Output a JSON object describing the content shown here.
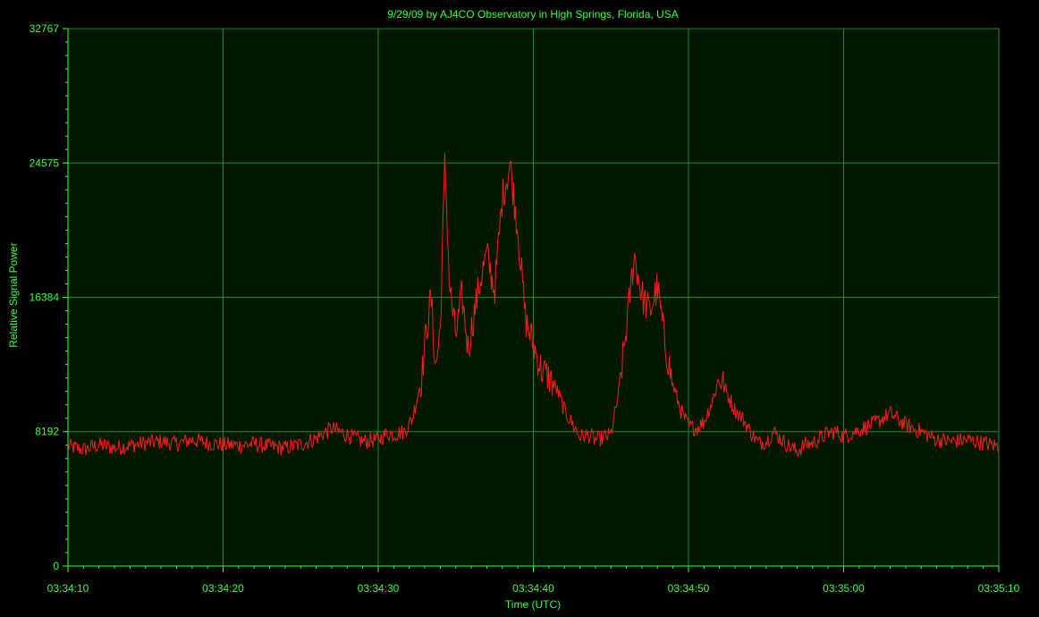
{
  "chart_data": {
    "type": "line",
    "title": "9/29/09  by  AJ4CO Observatory  in  High Springs, Florida, USA",
    "xlabel": "Time (UTC)",
    "ylabel": "Relative Signal Power",
    "x_start_seconds": 0,
    "x_end_seconds": 60,
    "xlim": [
      0,
      60
    ],
    "ylim": [
      0,
      32767
    ],
    "y_ticks": [
      0,
      8192,
      16384,
      24575,
      32767
    ],
    "x_tick_labels": [
      "03:34:10",
      "03:34:20",
      "03:34:30",
      "03:34:40",
      "03:34:50",
      "03:35:00",
      "03:35:10"
    ],
    "grid": true,
    "colors": {
      "background": "#000000",
      "plot_background": "#001800",
      "grid": "#1f8a1f",
      "text": "#33ff33",
      "series": "#ff1a1a"
    },
    "series": [
      {
        "x": [
          0,
          1,
          2,
          3,
          4,
          5,
          6,
          7,
          8,
          9,
          10,
          11,
          12,
          13,
          14,
          15,
          16,
          17,
          18,
          19,
          20,
          21,
          20.6,
          21.2,
          21.7,
          22.2,
          22.8,
          23,
          23.4,
          23.7,
          24,
          24.3,
          24.6,
          25,
          25.4,
          25.8,
          26.2,
          26.6,
          27,
          27.5,
          28,
          28.5,
          29,
          29.5,
          30,
          30.5,
          31,
          31.5,
          32,
          32.5,
          33,
          33.5,
          34,
          34.5,
          35,
          35.5,
          36,
          36.5,
          37,
          37.5,
          38,
          38.5,
          39,
          39.5,
          40,
          40.5,
          41,
          41.5,
          42,
          42.5,
          43,
          43.5,
          44,
          44.5,
          45,
          45.5,
          46,
          46.5,
          47,
          47.5,
          48,
          48.5,
          49,
          49.5,
          50,
          51,
          52,
          53,
          54,
          55,
          56,
          57,
          58,
          59,
          60
        ],
        "y": [
          7300,
          7100,
          7400,
          7200,
          7350,
          7500,
          7600,
          7450,
          7700,
          7500,
          7400,
          7350,
          7450,
          7300,
          7200,
          7400,
          7800,
          8400,
          8000,
          7600,
          7700,
          8000,
          8100,
          8100,
          8200,
          9000,
          11500,
          13500,
          16500,
          12000,
          14500,
          24800,
          17000,
          14000,
          16500,
          13200,
          15500,
          17500,
          19000,
          16800,
          22500,
          24500,
          20500,
          15000,
          13500,
          12000,
          11500,
          10800,
          9500,
          8700,
          7900,
          8000,
          7700,
          7800,
          8000,
          10500,
          14500,
          19000,
          16500,
          15500,
          17000,
          13500,
          11000,
          9500,
          8500,
          8400,
          8800,
          10000,
          11500,
          10500,
          9500,
          9000,
          8200,
          7500,
          7600,
          8200,
          7700,
          7300,
          7000,
          7400,
          7500,
          7800,
          8100,
          8200,
          7900,
          8300,
          8700,
          9300,
          8600,
          8200,
          7700,
          7600,
          7700,
          7500,
          7300
        ]
      }
    ]
  }
}
